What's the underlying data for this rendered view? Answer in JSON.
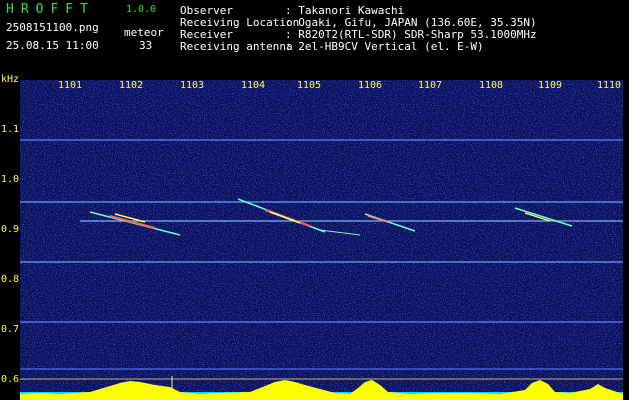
{
  "header": {
    "app_name": "HROFFT",
    "app_version": "1.0.0",
    "file_name": "2508151100.png",
    "timestamp": "25.08.15 11:00",
    "meteor_label": "meteor",
    "meteor_count": "33"
  },
  "info": [
    {
      "key": "Observer",
      "value": ": Takanori Kawachi"
    },
    {
      "key": "Receiving Location",
      "value": ": Ogaki, Gifu, JAPAN (136.60E, 35.35N)"
    },
    {
      "key": "Receiver",
      "value": ": R820T2(RTL-SDR) SDR-Sharp 53.1000MHz"
    },
    {
      "key": "Receiving antenna",
      "value": ": 2el-HB9CV Vertical (el. E-W)"
    }
  ],
  "axis": {
    "unit": "kHz",
    "minute_labels": [
      "1101",
      "1102",
      "1103",
      "1104",
      "1105",
      "1106",
      "1107",
      "1108",
      "1109",
      "1110"
    ],
    "khz_labels": [
      "1.1",
      "1.0",
      "0.9",
      "0.8",
      "0.7",
      "0.6"
    ]
  },
  "colors": {
    "background": "#000000",
    "spectrogram": "#0a0f5c",
    "text_green": "#33dd44",
    "text_yellow": "#ffff40",
    "echo": "#66ffcc",
    "meter": "#ffff00",
    "meter_base": "#00d8ff"
  }
}
